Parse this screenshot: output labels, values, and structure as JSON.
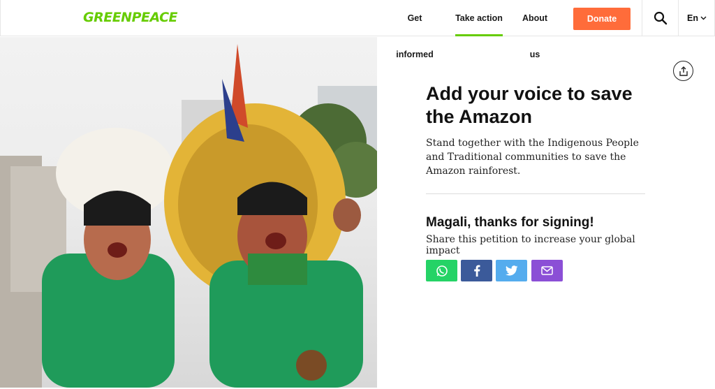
{
  "header": {
    "logo": "GREENPEACE",
    "nav": [
      {
        "label": "Get informed",
        "active": false
      },
      {
        "label": "Take action",
        "active": true
      },
      {
        "label": "About us",
        "active": false
      }
    ],
    "donate_label": "Donate",
    "language": "En"
  },
  "hero": {
    "image_desc": "indigenous-activists-photo"
  },
  "petition": {
    "title": "Add your voice to save the Amazon",
    "description": "Stand together with the Indigenous People and Traditional communities to save the Amazon rainforest.",
    "thanks": "Magali, thanks for signing!",
    "share_prompt": "Share this petition to increase your global impact"
  },
  "share_buttons": [
    {
      "name": "whatsapp-share-button",
      "icon": "whatsapp-icon",
      "color": "#25d366"
    },
    {
      "name": "facebook-share-button",
      "icon": "facebook-icon",
      "color": "#3b5a9a"
    },
    {
      "name": "twitter-share-button",
      "icon": "twitter-icon",
      "color": "#55acee"
    },
    {
      "name": "email-share-button",
      "icon": "envelope-icon",
      "color": "#8b4fd6"
    }
  ],
  "colors": {
    "brand_green": "#66cc00",
    "donate_orange": "#ff6c3a"
  }
}
